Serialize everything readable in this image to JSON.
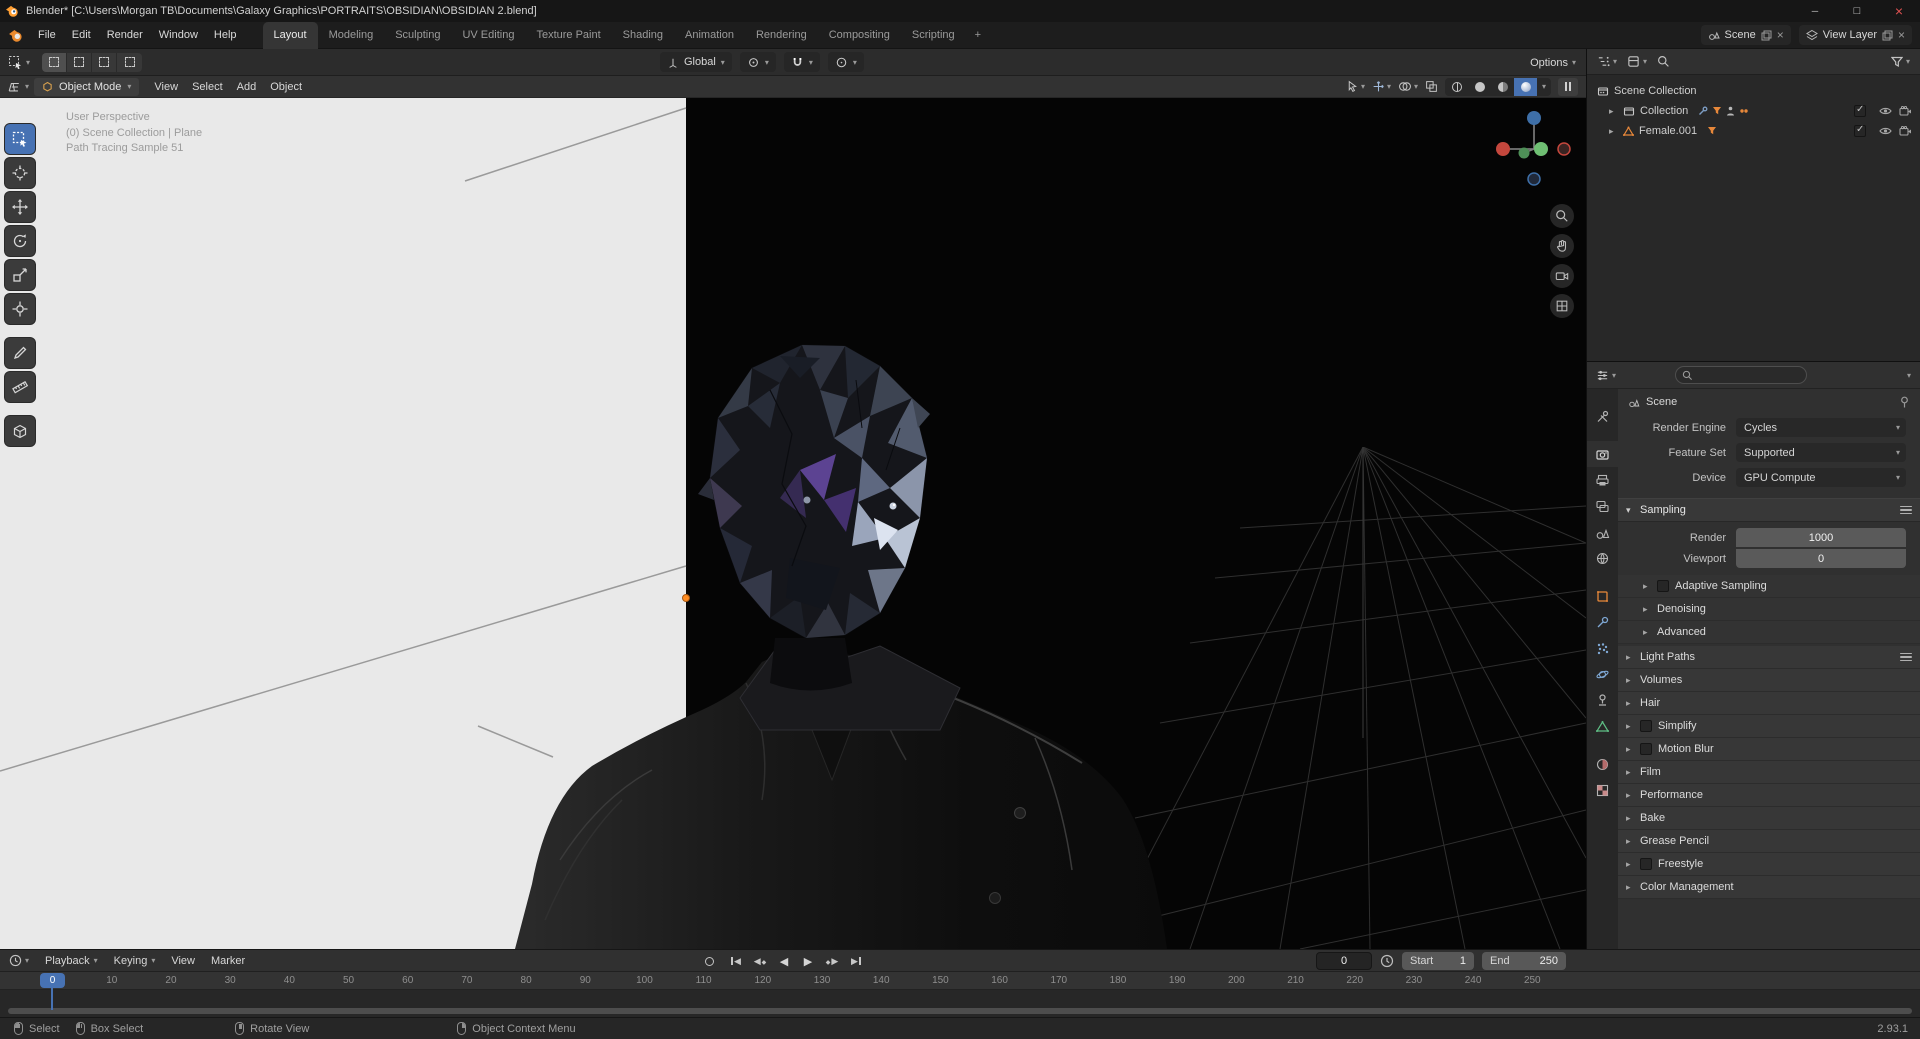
{
  "titlebar": {
    "title": "Blender* [C:\\Users\\Morgan TB\\Documents\\Galaxy Graphics\\PORTRAITS\\OBSIDIAN\\OBSIDIAN 2.blend]"
  },
  "topbar": {
    "menus": [
      "File",
      "Edit",
      "Render",
      "Window",
      "Help"
    ],
    "workspaces": [
      "Layout",
      "Modeling",
      "Sculpting",
      "UV Editing",
      "Texture Paint",
      "Shading",
      "Animation",
      "Rendering",
      "Compositing",
      "Scripting"
    ],
    "active_workspace": "Layout",
    "add_workspace": "+",
    "scene_selector": {
      "value": "Scene"
    },
    "view_layer_selector": {
      "value": "View Layer"
    }
  },
  "tool_settings": {
    "orientation_value": "Global",
    "options_label": "Options"
  },
  "viewport": {
    "mode": "Object Mode",
    "menus": [
      "View",
      "Select",
      "Add",
      "Object"
    ],
    "overlay": {
      "line1": "User Perspective",
      "line2": "(0) Scene Collection | Plane",
      "line3": "Path Tracing Sample 51"
    }
  },
  "outliner": {
    "rows": [
      {
        "label": "Scene Collection"
      },
      {
        "label": "Collection"
      },
      {
        "label": "Female.001"
      }
    ]
  },
  "properties": {
    "breadcrumb": "Scene",
    "render_engine_label": "Render Engine",
    "render_engine_value": "Cycles",
    "feature_set_label": "Feature Set",
    "feature_set_value": "Supported",
    "device_label": "Device",
    "device_value": "GPU Compute",
    "sampling_title": "Sampling",
    "sampling_render_label": "Render",
    "sampling_render_value": "1000",
    "sampling_viewport_label": "Viewport",
    "sampling_viewport_value": "0",
    "subpanels": [
      {
        "label": "Adaptive Sampling",
        "checkbox": true
      },
      {
        "label": "Denoising"
      },
      {
        "label": "Advanced"
      }
    ],
    "panels": [
      {
        "label": "Light Paths",
        "menu": true
      },
      {
        "label": "Volumes"
      },
      {
        "label": "Hair"
      },
      {
        "label": "Simplify",
        "checkbox": true
      },
      {
        "label": "Motion Blur",
        "checkbox": true
      },
      {
        "label": "Film"
      },
      {
        "label": "Performance"
      },
      {
        "label": "Bake"
      },
      {
        "label": "Grease Pencil"
      },
      {
        "label": "Freestyle",
        "checkbox": true
      },
      {
        "label": "Color Management"
      }
    ]
  },
  "timeline": {
    "menus": [
      {
        "label": "Playback",
        "caret": true
      },
      {
        "label": "Keying",
        "caret": true
      },
      {
        "label": "View"
      },
      {
        "label": "Marker"
      }
    ],
    "current_frame": "0",
    "start_label": "Start",
    "start_value": "1",
    "end_label": "End",
    "end_value": "250",
    "playhead": "0",
    "ticks": [
      "0",
      "10",
      "20",
      "30",
      "40",
      "50",
      "60",
      "70",
      "80",
      "90",
      "100",
      "110",
      "120",
      "130",
      "140",
      "150",
      "160",
      "170",
      "180",
      "190",
      "200",
      "210",
      "220",
      "230",
      "240",
      "250"
    ]
  },
  "statusbar": {
    "hints": [
      {
        "label": "Select",
        "icon": "m-left"
      },
      {
        "label": "Box Select",
        "icon": "m-left-drag"
      },
      {
        "label": "Rotate View",
        "icon": "m-middle"
      },
      {
        "label": "Object Context Menu",
        "icon": "m-right"
      }
    ],
    "version": "2.93.1"
  },
  "colors": {
    "accent": "#4772b3",
    "object_orange": "#e8883a",
    "data_green": "#5fbf85",
    "viewport_backdrop": "#e9e9e9",
    "viewport_bg": "#050505"
  }
}
